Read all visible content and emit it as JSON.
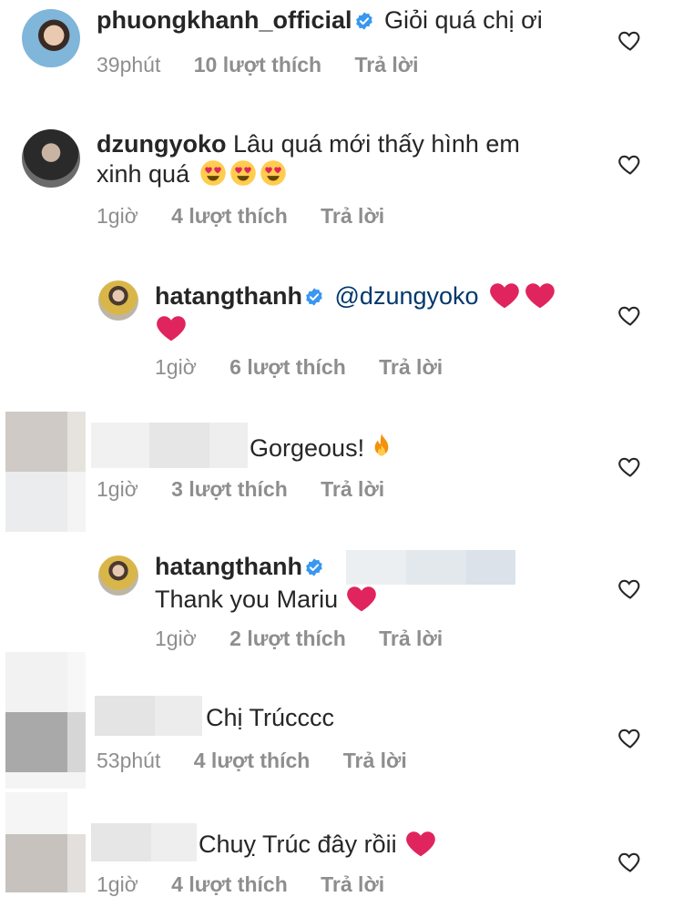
{
  "comments": [
    {
      "user": "phuongkhanh_official",
      "verified": true,
      "text": "Giỏi quá chị ơi",
      "time": "39phút",
      "likes": "10 lượt thích",
      "reply": "Trả lời"
    },
    {
      "user": "dzungyoko",
      "verified": false,
      "text": "Lâu quá mới thấy hình em",
      "text2": "xinh quá",
      "time": "1giờ",
      "likes": "4 lượt thích",
      "reply": "Trả lời"
    },
    {
      "user": "hatangthanh",
      "verified": true,
      "mention": "@dzungyoko",
      "time": "1giờ",
      "likes": "6 lượt thích",
      "reply": "Trả lời"
    },
    {
      "text": "Gorgeous!",
      "time": "1giờ",
      "likes": "3 lượt thích",
      "reply": "Trả lời"
    },
    {
      "user": "hatangthanh",
      "verified": true,
      "text": "Thank you Mariu",
      "time": "1giờ",
      "likes": "2 lượt thích",
      "reply": "Trả lời"
    },
    {
      "text": "Chị Trúcccc",
      "time": "53phút",
      "likes": "4 lượt thích",
      "reply": "Trả lời"
    },
    {
      "text": "Chuỵ Trúc đây rồii",
      "time": "1giờ",
      "likes": "4 lượt thích",
      "reply": "Trả lời"
    }
  ],
  "icons": {
    "like": "heart-outline-icon",
    "verified": "verified-badge-icon",
    "red_heart": "red-heart-emoji",
    "fire": "fire-emoji",
    "heart_eyes": "heart-eyes-emoji"
  },
  "colors": {
    "username": "#262626",
    "meta": "#8e8e8e",
    "mention": "#00376b",
    "verified": "#3897f0",
    "heart": "#e0245e"
  }
}
